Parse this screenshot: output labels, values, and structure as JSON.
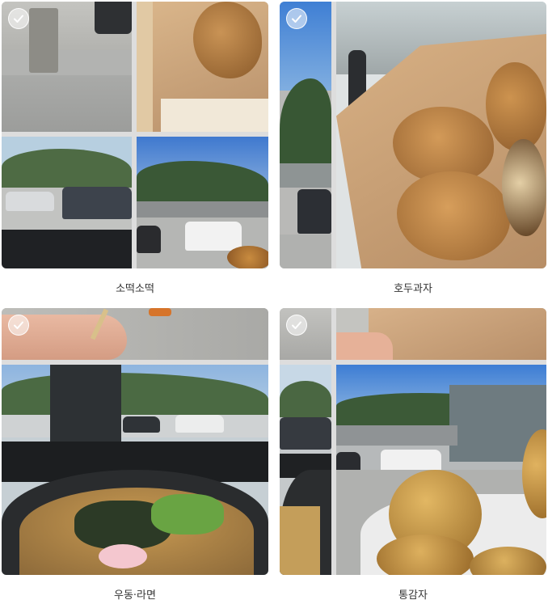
{
  "cards": [
    {
      "caption": "소떡소떡",
      "selected": true
    },
    {
      "caption": "호두과자",
      "selected": true
    },
    {
      "caption": "우동·라면",
      "selected": true
    },
    {
      "caption": "통감자",
      "selected": true
    }
  ],
  "colors": {
    "sky": "#5b8fd6",
    "mountain": "#3d5a3a",
    "pavement": "#a9a9a6",
    "paper_bag": "#c9a27a",
    "pastry": "#b9813f",
    "potato": "#c99d4c"
  },
  "icons": {
    "select": "check-icon"
  }
}
